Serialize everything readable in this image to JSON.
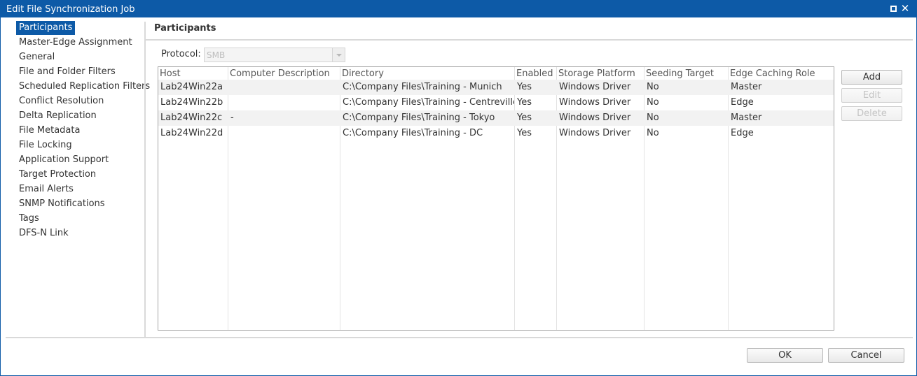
{
  "window": {
    "title": "Edit File Synchronization Job",
    "title_bar_color": "#0d5aa7",
    "maximize_icon": "maximize-icon",
    "close_icon": "close-icon",
    "close_glyph": "✕"
  },
  "sidebar": {
    "active_index": 0,
    "items": [
      {
        "label": "Participants"
      },
      {
        "label": "Master-Edge Assignment"
      },
      {
        "label": "General"
      },
      {
        "label": "File and Folder Filters"
      },
      {
        "label": "Scheduled Replication Filters"
      },
      {
        "label": "Conflict Resolution"
      },
      {
        "label": "Delta Replication"
      },
      {
        "label": "File Metadata"
      },
      {
        "label": "File Locking"
      },
      {
        "label": "Application Support"
      },
      {
        "label": "Target Protection"
      },
      {
        "label": "Email Alerts"
      },
      {
        "label": "SNMP Notifications"
      },
      {
        "label": "Tags"
      },
      {
        "label": "DFS-N Link"
      }
    ]
  },
  "main": {
    "section_title": "Participants",
    "protocol": {
      "label": "Protocol:",
      "value": "SMB",
      "disabled": true
    },
    "table": {
      "columns": [
        "Host",
        "Computer Description",
        "Directory",
        "Enabled",
        "Storage Platform",
        "Seeding Target",
        "Edge Caching Role"
      ],
      "rows": [
        [
          "Lab24Win22a",
          "",
          "C:\\Company Files\\Training - Munich",
          "Yes",
          "Windows Driver",
          "No",
          "Master"
        ],
        [
          "Lab24Win22b",
          "",
          "C:\\Company Files\\Training - Centreville",
          "Yes",
          "Windows Driver",
          "No",
          "Edge"
        ],
        [
          "Lab24Win22c",
          "-",
          "C:\\Company Files\\Training - Tokyo",
          "Yes",
          "Windows Driver",
          "No",
          "Master"
        ],
        [
          "Lab24Win22d",
          "",
          "C:\\Company Files\\Training - DC",
          "Yes",
          "Windows Driver",
          "No",
          "Edge"
        ]
      ]
    },
    "buttons": {
      "add": {
        "label": "Add",
        "enabled": true
      },
      "edit": {
        "label": "Edit",
        "enabled": false
      },
      "delete": {
        "label": "Delete",
        "enabled": false
      }
    }
  },
  "footer": {
    "ok_label": "OK",
    "cancel_label": "Cancel"
  }
}
